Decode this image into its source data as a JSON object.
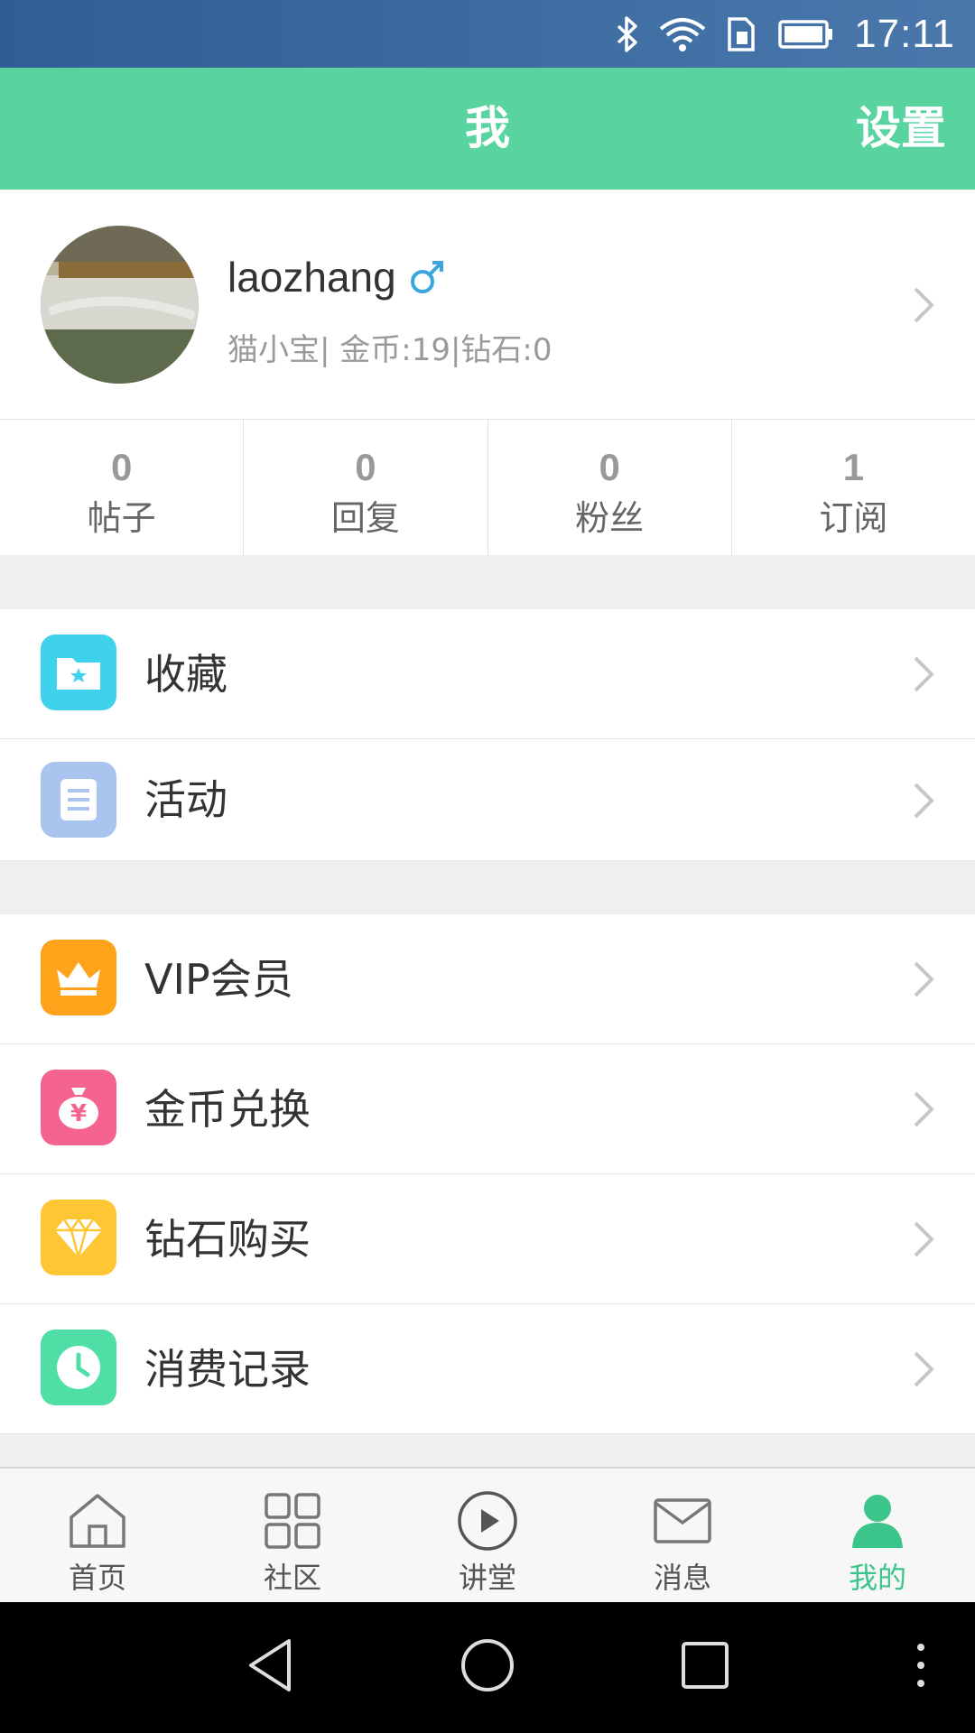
{
  "status_bar": {
    "time": "17:11",
    "icons": [
      "bluetooth-icon",
      "wifi-icon",
      "sim-icon",
      "battery-icon"
    ]
  },
  "header": {
    "title": "我",
    "settings_label": "设置",
    "color": "#59d39f"
  },
  "profile": {
    "username": "laozhang",
    "gender_icon": "male-icon",
    "subtitle": "猫小宝|  金币:19|钻石:0"
  },
  "stats": [
    {
      "value": "0",
      "label": "帖子"
    },
    {
      "value": "0",
      "label": "回复"
    },
    {
      "value": "0",
      "label": "粉丝"
    },
    {
      "value": "1",
      "label": "订阅"
    }
  ],
  "menu_group_1": [
    {
      "label": "收藏",
      "icon": "favorites-folder-icon",
      "color": "#3fd2ec"
    },
    {
      "label": "活动",
      "icon": "activity-document-icon",
      "color": "#a8c4ef"
    }
  ],
  "menu_group_2": [
    {
      "label": "VIP会员",
      "icon": "crown-icon",
      "color": "#ffa31a"
    },
    {
      "label": "金币兑换",
      "icon": "money-bag-icon",
      "color": "#f5648e"
    },
    {
      "label": "钻石购买",
      "icon": "diamond-icon",
      "color": "#ffc633"
    },
    {
      "label": "消费记录",
      "icon": "clock-icon",
      "color": "#4fdfa6"
    }
  ],
  "tabs": [
    {
      "label": "首页",
      "icon": "home-icon",
      "active": false
    },
    {
      "label": "社区",
      "icon": "grid-icon",
      "active": false
    },
    {
      "label": "讲堂",
      "icon": "play-icon",
      "active": false
    },
    {
      "label": "消息",
      "icon": "mail-icon",
      "active": false
    },
    {
      "label": "我的",
      "icon": "user-icon",
      "active": true
    }
  ],
  "active_color": "#3cc58a",
  "nav_bar": [
    "back-icon",
    "home-circle-icon",
    "recents-icon",
    "more-icon"
  ]
}
